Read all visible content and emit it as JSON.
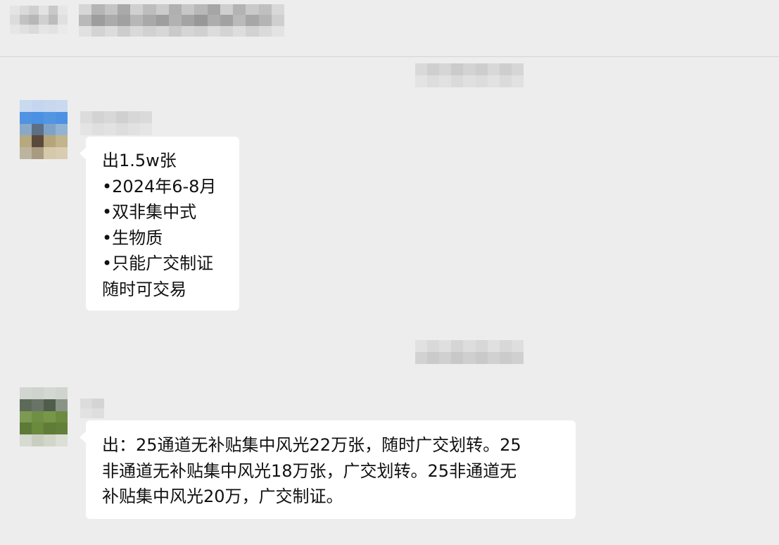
{
  "messages": [
    {
      "lines": [
        "出1.5w张",
        "•2024年6-8月",
        "•双非集中式",
        "•生物质",
        "•只能广交制证",
        "随时可交易"
      ]
    },
    {
      "lines": [
        "出：25通道无补贴集中风光22万张，随时广交划转。25",
        "非通道无补贴集中风光18万张，广交划转。25非通道无",
        "补贴集中风光20万，广交制证。"
      ]
    }
  ],
  "colors": {
    "background": "#ededed",
    "bubble": "#ffffff",
    "text": "#111111"
  }
}
